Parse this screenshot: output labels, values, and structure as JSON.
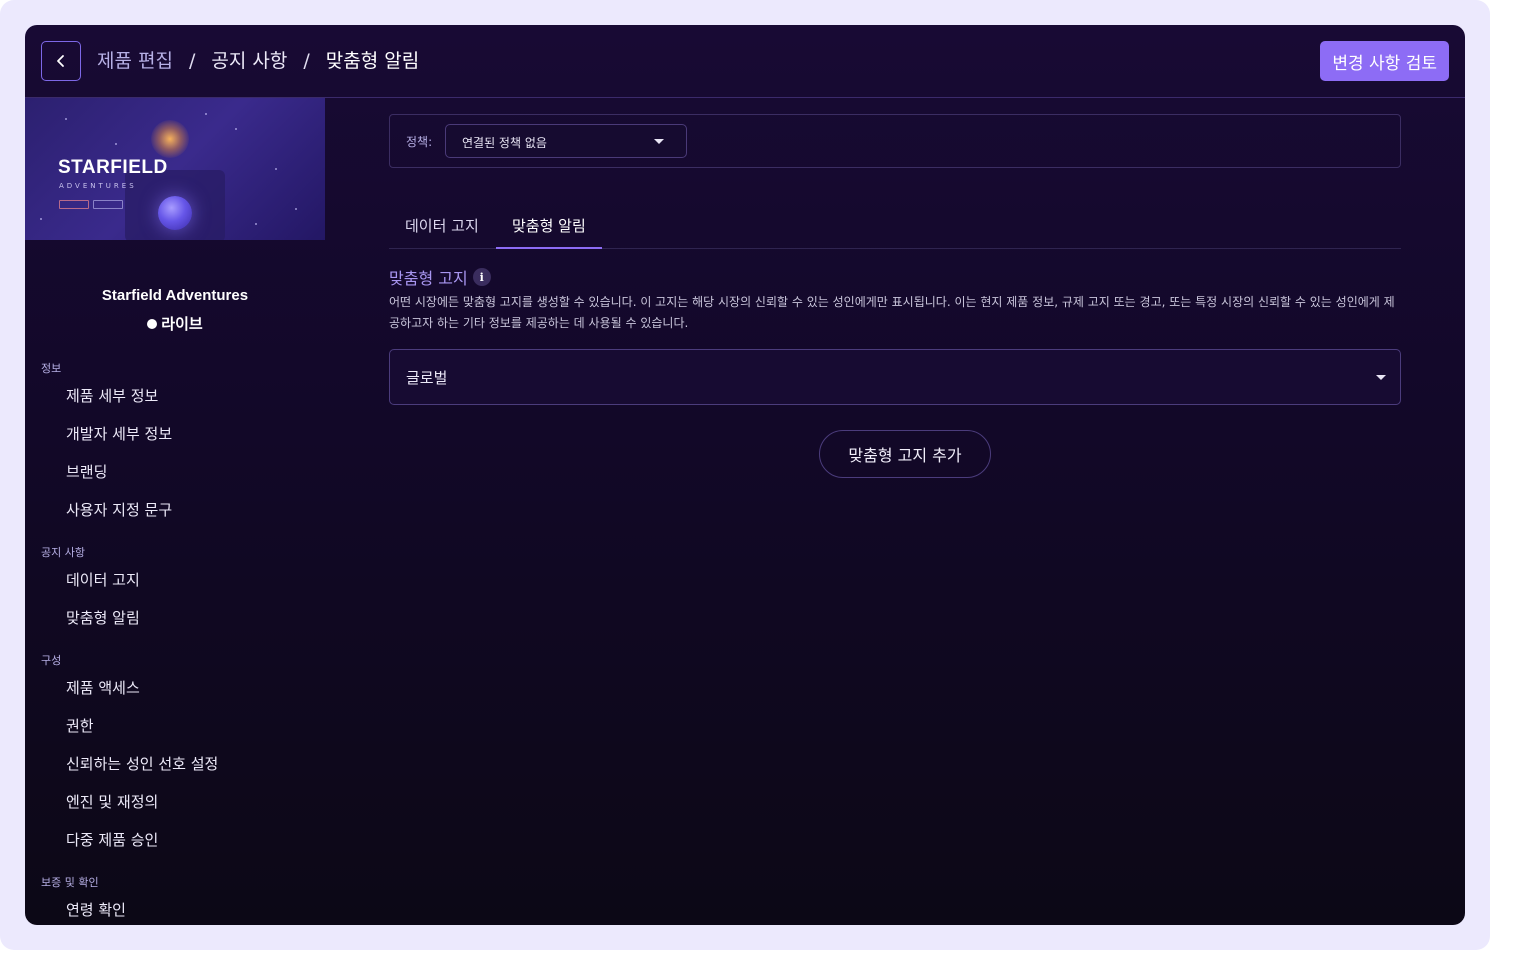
{
  "header": {
    "breadcrumb": [
      "제품 편집",
      "공지 사항",
      "맞춤형 알림"
    ],
    "separator": "/",
    "review_button": "변경 사항 검토"
  },
  "product": {
    "name": "Starfield Adventures",
    "status": "라이브",
    "thumbnail": {
      "logo_text": "STARFIELD",
      "logo_sub": "ADVENTURES"
    }
  },
  "sidebar": {
    "sections": [
      {
        "label": "정보",
        "items": [
          "제품 세부 정보",
          "개발자 세부 정보",
          "브랜딩",
          "사용자 지정 문구"
        ]
      },
      {
        "label": "공지 사항",
        "items": [
          "데이터 고지",
          "맞춤형 알림"
        ]
      },
      {
        "label": "구성",
        "items": [
          "제품 액세스",
          "권한",
          "신뢰하는 성인 선호 설정",
          "엔진 및 재정의",
          "다중 제품 승인"
        ]
      },
      {
        "label": "보증 및 확인",
        "items": [
          "연령 확인"
        ]
      }
    ]
  },
  "policy": {
    "label": "정책:",
    "selected": "연결된 정책 없음"
  },
  "tabs": [
    {
      "label": "데이터 고지",
      "active": false
    },
    {
      "label": "맞춤형 알림",
      "active": true
    }
  ],
  "notice_section": {
    "title": "맞춤형 고지",
    "info_icon": "i",
    "description": "어떤 시장에든 맞춤형 고지를 생성할 수 있습니다. 이 고지는 해당 시장의 신뢰할 수 있는 성인에게만 표시됩니다. 이는 현지 제품 정보, 규제 고지 또는 경고, 또는 특정 시장의 신뢰할 수 있는 성인에게 제공하고자 하는 기타 정보를 제공하는 데 사용될 수 있습니다.",
    "market_select": "글로벌",
    "add_button": "맞춤형 고지 추가"
  },
  "colors": {
    "accent": "#8d6cf5",
    "frame": "#ece9fd",
    "background_top": "#180a34",
    "background_bottom": "#0c0816",
    "section_title": "#a896f0"
  },
  "icons": {
    "back": "chevron-left-icon",
    "dropdown": "caret-down-icon",
    "info": "info-icon",
    "status": "live-dot-icon"
  }
}
